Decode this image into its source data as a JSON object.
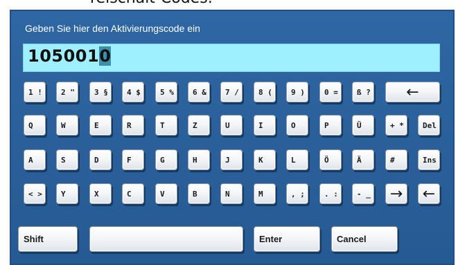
{
  "top_text": "reischalt-Codes:",
  "dialog": {
    "title": "Geben Sie hier den Aktivierungscode ein",
    "code_value": "105001",
    "code_cursor_char": "0"
  },
  "keyboard": {
    "row1": [
      "1 !",
      "2 \"",
      "3 §",
      "4 $",
      "5 %",
      "6 &",
      "7 /",
      "8 (",
      "9 )",
      "0 =",
      "ß ?"
    ],
    "backspace_icon": "←",
    "row2": [
      "Q",
      "W",
      "E",
      "R",
      "T",
      "Z",
      "U",
      "I",
      "O",
      "P",
      "Ü",
      "+ *",
      "Del"
    ],
    "row3": [
      "A",
      "S",
      "D",
      "F",
      "G",
      "H",
      "J",
      "K",
      "L",
      "Ö",
      "Ä",
      "#",
      "Ins"
    ],
    "row4": [
      "< >",
      "Y",
      "X",
      "C",
      "V",
      "B",
      "N",
      "M",
      ", ;",
      ". :",
      "- _"
    ],
    "arrow_right_icon": "→",
    "arrow_left_icon": "←",
    "shift_label": "Shift",
    "space_label": "",
    "enter_label": "Enter",
    "cancel_label": "Cancel"
  },
  "colors": {
    "panel_blue": "#2f67a4",
    "field_cyan": "#9ff0ff",
    "key_face": "#f4f6f8"
  },
  "icons": {
    "backspace": "left-arrow-icon",
    "cursor_right": "right-arrow-icon",
    "cursor_left": "left-arrow-icon"
  }
}
